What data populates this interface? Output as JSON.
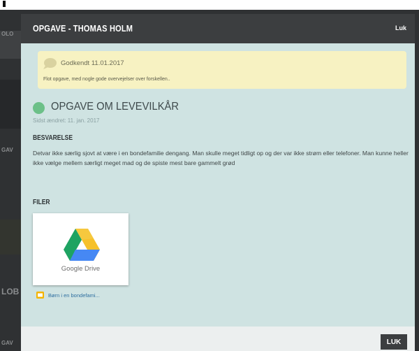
{
  "background": {
    "side_labels": [
      "OLO",
      "GAV",
      "LOB",
      "GAV"
    ]
  },
  "modal": {
    "title": "OPGAVE - THOMAS HOLM",
    "close_top_label": "Luk",
    "approval": {
      "icon": "speech-bubble-icon",
      "status": "Godkendt 11.01.2017",
      "comment": "Flot opgave, med nogle gode overvejelser over forskellen.."
    },
    "task": {
      "status_color": "#6cc088",
      "title": "OPGAVE OM LEVEVILKÅR",
      "edited": "Sidst ændret: 11. jan. 2017"
    },
    "answer": {
      "heading": "BESVARELSE",
      "text": "Detvar ikke særlig sjovt at være i en bondefamilie dengang. Man skulle meget tidligt op og der var ikke strøm eller telefoner. Man kunne heller ikke vælge mellem særligt meget mad og de spiste mest bare gammelt grød"
    },
    "files": {
      "heading": "FILER",
      "items": [
        {
          "service": "Google Drive",
          "icon": "google-drive-icon",
          "name": "Børn i en bondefami..."
        }
      ]
    },
    "footer": {
      "close_label": "LUK"
    }
  },
  "colors": {
    "header": "#3c3e40",
    "modal_bg": "#cfe3e2",
    "approval_bg": "#f7f2c2",
    "link": "#2e6fa0"
  }
}
